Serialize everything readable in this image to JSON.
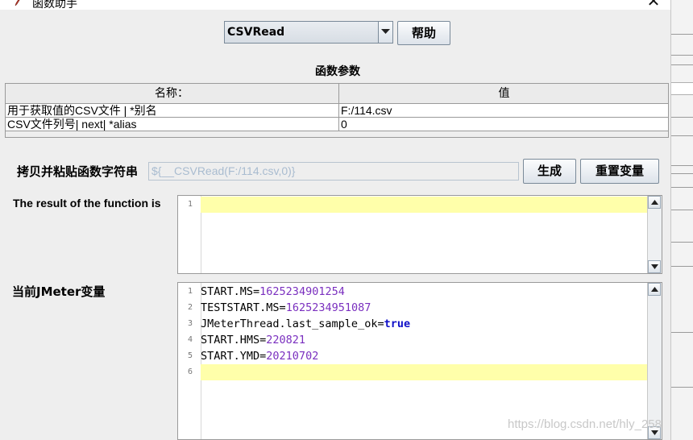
{
  "window": {
    "title": "函数助手",
    "close_glyph": "✕"
  },
  "function_select": {
    "selected": "CSVRead"
  },
  "help_button": "帮助",
  "params_section_title": "函数参数",
  "params_table": {
    "headers": [
      "名称：",
      "值"
    ],
    "rows": [
      {
        "name": "用于获取值的CSV文件 | *别名",
        "value": "F:/114.csv"
      },
      {
        "name": "CSV文件列号| next| *alias",
        "value": "0"
      }
    ]
  },
  "copy_paste": {
    "label": "拷贝并粘贴函数字符串",
    "value": "${__CSVRead(F:/114.csv,0)}",
    "generate_button": "生成",
    "reset_button": "重置变量"
  },
  "result": {
    "label": "The result of the function is",
    "line_numbers": [
      "1"
    ]
  },
  "jmeter_vars": {
    "label": "当前JMeter变量",
    "lines": [
      {
        "n": "1",
        "key": "START.MS",
        "value": "1625234901254",
        "kind": "number"
      },
      {
        "n": "2",
        "key": "TESTSTART.MS",
        "value": "1625234951087",
        "kind": "number"
      },
      {
        "n": "3",
        "key": "JMeterThread.last_sample_ok",
        "value": "true",
        "kind": "bool"
      },
      {
        "n": "4",
        "key": "START.HMS",
        "value": "220821",
        "kind": "number"
      },
      {
        "n": "5",
        "key": "START.YMD",
        "value": "20210702",
        "kind": "number"
      },
      {
        "n": "6",
        "key": "",
        "value": "",
        "kind": "empty"
      }
    ]
  },
  "watermark": "https://blog.csdn.net/hly_258",
  "colors": {
    "highlight": "#ffffaa",
    "number": "#7a2fbf",
    "keyword": "#1010c8"
  }
}
